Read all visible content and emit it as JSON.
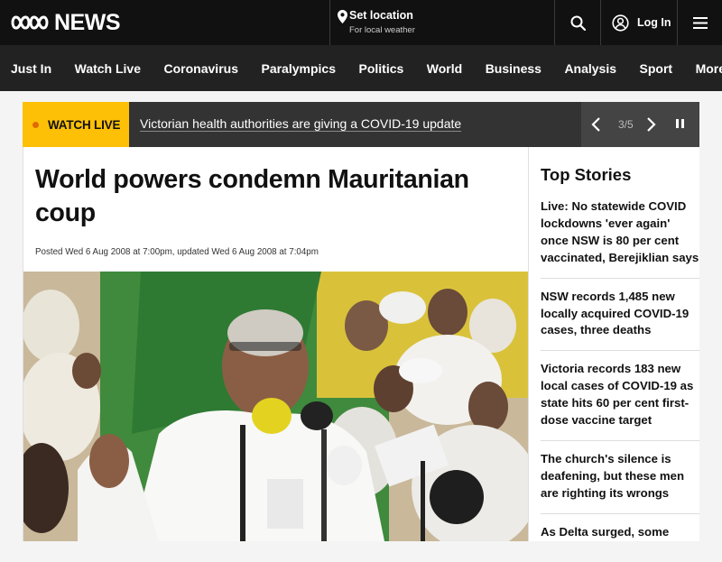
{
  "header": {
    "logo_text": "NEWS",
    "location_title": "Set location",
    "location_subtitle": "For local weather",
    "login_label": "Log In"
  },
  "nav": {
    "items": [
      "Just In",
      "Watch Live",
      "Coronavirus",
      "Paralympics",
      "Politics",
      "World",
      "Business",
      "Analysis",
      "Sport"
    ],
    "more_label": "More"
  },
  "watch_live": {
    "badge": "WATCH LIVE",
    "headline": "Victorian health authorities are giving a COVID-19 update",
    "counter": "3/5"
  },
  "article": {
    "title": "World powers condemn Mauritanian coup",
    "meta": "Posted Wed 6 Aug 2008 at 7:00pm, updated Wed 6 Aug 2008 at 7:04pm"
  },
  "sidebar": {
    "heading": "Top Stories",
    "stories": [
      "Live: No statewide COVID lockdowns 'ever again' once NSW is 80 per cent vaccinated, Berejiklian says",
      "NSW records 1,485 new locally acquired COVID-19 cases, three deaths",
      "Victoria records 183 new local cases of COVID-19 as state hits 60 per cent first-dose vaccine target",
      "The church's silence is deafening, but these men are righting its wrongs",
      "As Delta surged, some"
    ]
  },
  "colors": {
    "topbar": "#111111",
    "navbar": "#222222",
    "watch_live_badge": "#fdc006",
    "watch_live_bar": "#333333"
  }
}
